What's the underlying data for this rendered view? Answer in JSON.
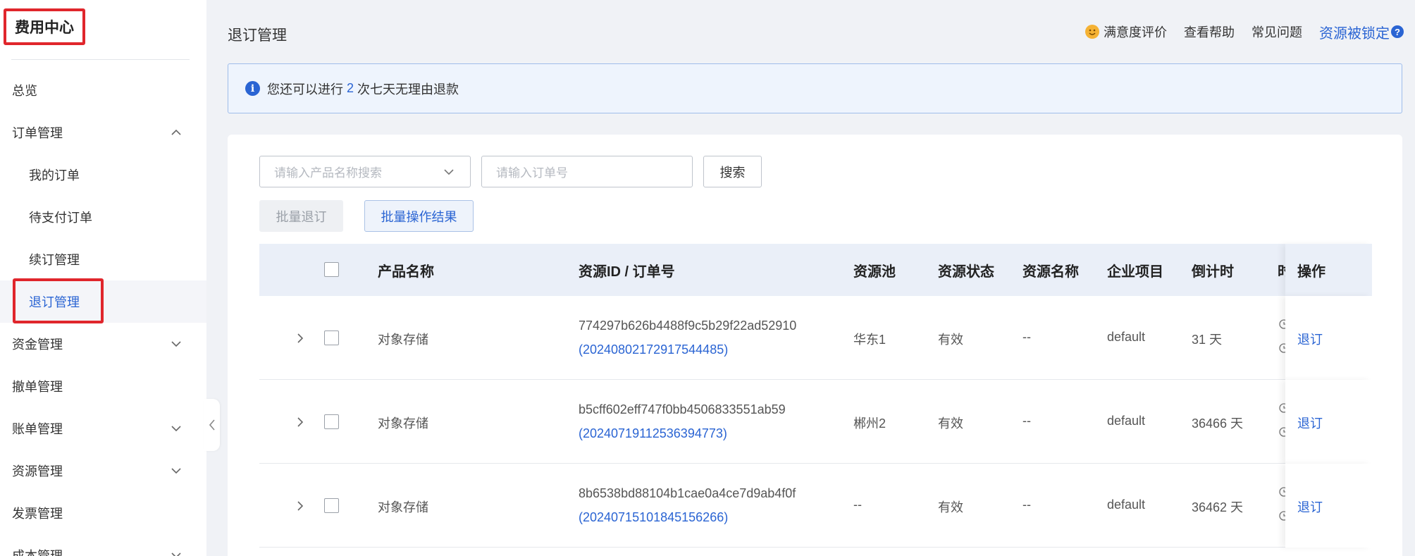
{
  "sidebar": {
    "title": "费用中心",
    "items": [
      {
        "label": "总览",
        "expanded": null
      },
      {
        "label": "订单管理",
        "expanded": true
      },
      {
        "label": "我的订单",
        "sub": true
      },
      {
        "label": "待支付订单",
        "sub": true
      },
      {
        "label": "续订管理",
        "sub": true
      },
      {
        "label": "退订管理",
        "sub": true,
        "active": true
      },
      {
        "label": "资金管理",
        "expanded": false
      },
      {
        "label": "撤单管理"
      },
      {
        "label": "账单管理",
        "expanded": false
      },
      {
        "label": "资源管理",
        "expanded": false
      },
      {
        "label": "发票管理"
      },
      {
        "label": "成本管理",
        "expanded": false
      }
    ]
  },
  "header": {
    "title": "退订管理",
    "links": {
      "satisfaction": "满意度评价",
      "help": "查看帮助",
      "faq": "常见问题",
      "locked": "资源被锁定"
    }
  },
  "notice": {
    "prefix": "您还可以进行",
    "count": "2",
    "suffix": "次七天无理由退款"
  },
  "filters": {
    "product_placeholder": "请输入产品名称搜索",
    "order_placeholder": "请输入订单号",
    "search_label": "搜索"
  },
  "actions": {
    "batch_unsubscribe": "批量退订",
    "batch_result": "批量操作结果"
  },
  "table": {
    "headers": [
      "产品名称",
      "资源ID / 订单号",
      "资源池",
      "资源状态",
      "资源名称",
      "企业项目",
      "倒计时",
      "时",
      "操作"
    ],
    "rows": [
      {
        "product": "对象存储",
        "resource_id": "774297b626b4488f9c5b29f22ad52910",
        "order_id": "(20240802172917544485)",
        "pool": "华东1",
        "status": "有效",
        "name": "--",
        "project": "default",
        "countdown": "31 天",
        "op": "退订"
      },
      {
        "product": "对象存储",
        "resource_id": "b5cff602eff747f0bb4506833551ab59",
        "order_id": "(20240719112536394773)",
        "pool": "郴州2",
        "status": "有效",
        "name": "--",
        "project": "default",
        "countdown": "36466 天",
        "op": "退订"
      },
      {
        "product": "对象存储",
        "resource_id": "8b6538bd88104b1cae0a4ce7d9ab4f0f",
        "order_id": "(20240715101845156266)",
        "pool": "--",
        "status": "有效",
        "name": "--",
        "project": "default",
        "countdown": "36462 天",
        "op": "退订"
      }
    ]
  },
  "colors": {
    "accent": "#2a64d3",
    "highlight_box": "#e0262c",
    "page_bg": "#f0f2f6",
    "table_header_bg": "#eaeff8"
  }
}
